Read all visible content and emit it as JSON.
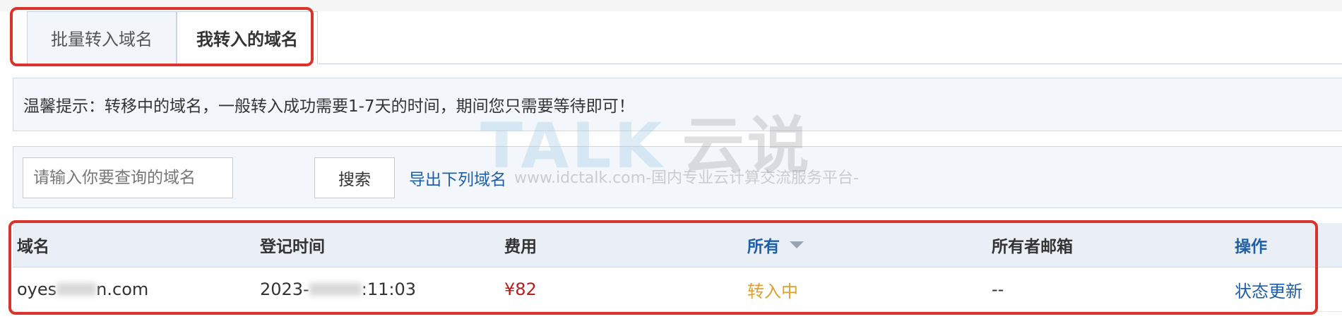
{
  "tabs": [
    {
      "label": "批量转入域名",
      "active": false
    },
    {
      "label": "我转入的域名",
      "active": true
    }
  ],
  "notice": {
    "text": "温馨提示：转移中的域名，一般转入成功需要1-7天的时间，期间您只需要等待即可！"
  },
  "search": {
    "placeholder": "请输入你要查询的域名",
    "value": "",
    "button_label": "搜索",
    "export_label": "导出下列域名"
  },
  "watermark": {
    "logo_text": "TALK",
    "logo_cn": "云说",
    "subtext": "www.idctalk.com-国内专业云计算交流服务平台-"
  },
  "table": {
    "columns": [
      "域名",
      "登记时间",
      "费用",
      "所有",
      "所有者邮箱",
      "操作"
    ],
    "rows": [
      {
        "domain_prefix": "oyes",
        "domain_suffix": "n.com",
        "reg_prefix": "2023-",
        "reg_suffix": ":11:03",
        "fee": "¥82",
        "status": "转入中",
        "email": "--",
        "action": "状态更新"
      }
    ]
  },
  "colors": {
    "accent_link": "#1f5fa8",
    "highlight": "#d9342b",
    "fee": "#b22020",
    "status_pending": "#e0a030"
  }
}
